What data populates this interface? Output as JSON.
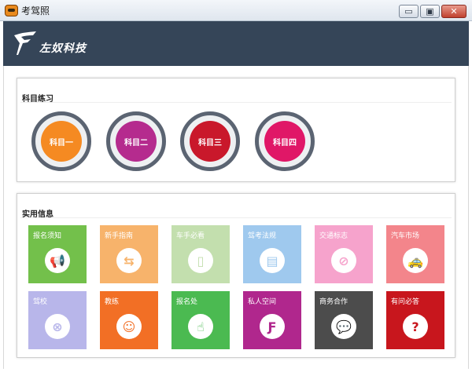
{
  "window": {
    "title": "考驾照",
    "minimize": "▭",
    "maximize": "▣",
    "close": "✕"
  },
  "brand": {
    "name": "左奴科技"
  },
  "subjects": {
    "title": "科目练习",
    "items": [
      {
        "label": "科目一",
        "color": "#f58a22"
      },
      {
        "label": "科目二",
        "color": "#b52b8e"
      },
      {
        "label": "科目三",
        "color": "#c9182b"
      },
      {
        "label": "科目四",
        "color": "#e01767"
      }
    ]
  },
  "info": {
    "title": "实用信息",
    "tiles": [
      {
        "label": "报名须知",
        "color": "#73c04b",
        "icon": "megaphone-icon",
        "glyph": "📢"
      },
      {
        "label": "新手指南",
        "color": "#f7b36b",
        "icon": "signpost-icon",
        "glyph": "⇆"
      },
      {
        "label": "车手必看",
        "color": "#c3dfae",
        "icon": "book-icon",
        "glyph": "▯"
      },
      {
        "label": "驾考法规",
        "color": "#9fc9ee",
        "icon": "document-icon",
        "glyph": "▤"
      },
      {
        "label": "交通标志",
        "color": "#f6a3cc",
        "icon": "no-parking-icon",
        "glyph": "⊘"
      },
      {
        "label": "汽车市场",
        "color": "#f3858b",
        "icon": "taxi-icon",
        "glyph": "🚕"
      },
      {
        "label": "驾校",
        "color": "#b8b6ea",
        "icon": "steering-wheel-icon",
        "glyph": "⊗"
      },
      {
        "label": "教练",
        "color": "#f26f25",
        "icon": "person-icon",
        "glyph": "☺"
      },
      {
        "label": "报名处",
        "color": "#4bba51",
        "icon": "hand-pointer-icon",
        "glyph": "☝"
      },
      {
        "label": "私人空间",
        "color": "#b0278d",
        "icon": "logo-icon",
        "glyph": "Ƒ"
      },
      {
        "label": "商务合作",
        "color": "#4c4c4c",
        "icon": "chat-icon",
        "glyph": "💬"
      },
      {
        "label": "有问必答",
        "color": "#c8161d",
        "icon": "question-icon",
        "glyph": "?"
      }
    ]
  }
}
